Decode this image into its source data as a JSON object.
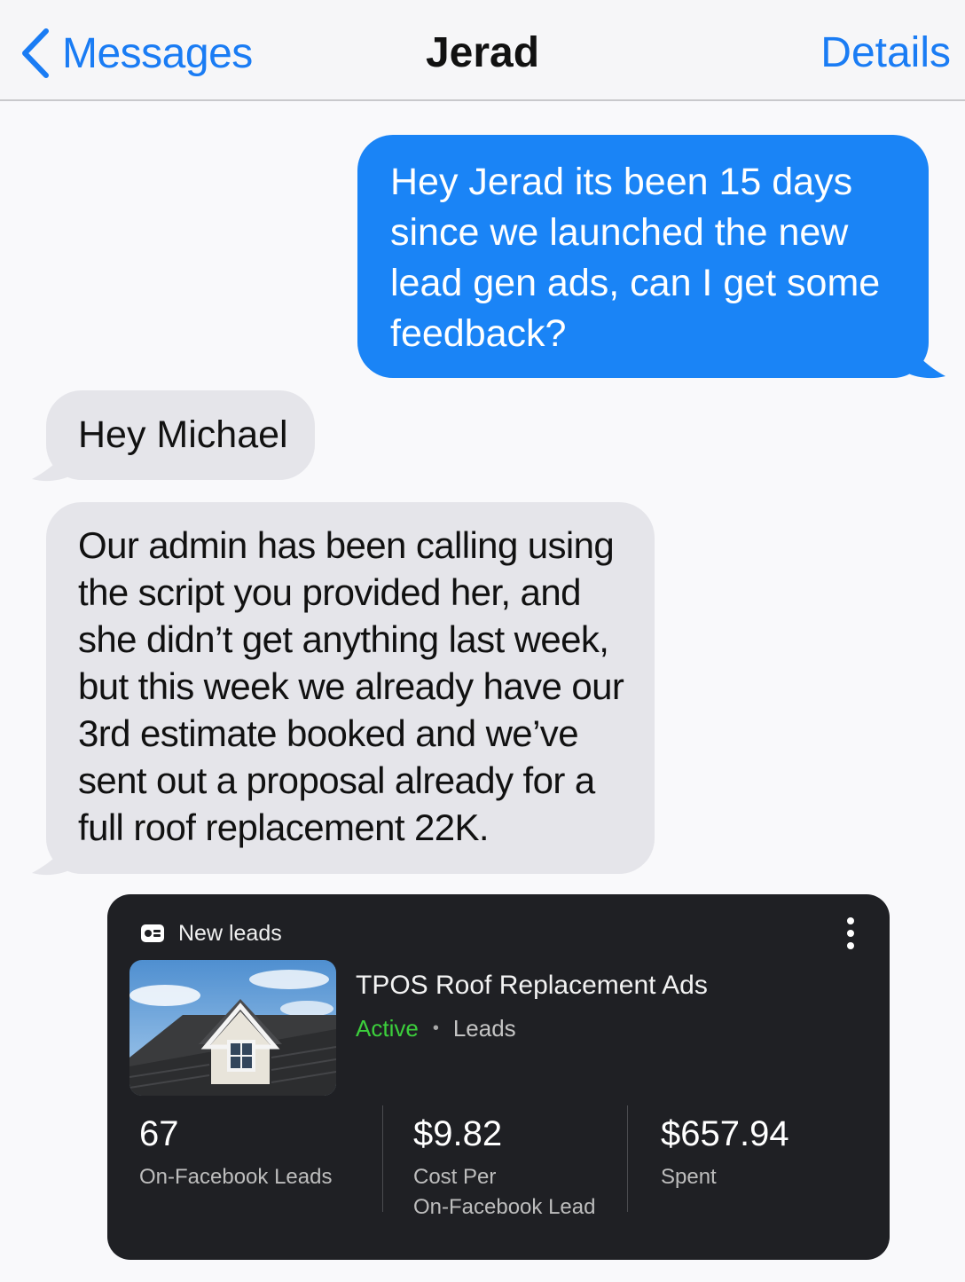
{
  "nav": {
    "back_label": "Messages",
    "title": "Jerad",
    "details_label": "Details"
  },
  "messages": [
    {
      "direction": "outgoing",
      "text": "Hey Jerad its been 15 days since we launched the new lead gen ads, can I get some feedback?"
    },
    {
      "direction": "incoming",
      "text": "Hey Michael"
    },
    {
      "direction": "incoming",
      "text": "Our admin has been calling using the script you provided her, and she didn’t get anything last week, but this week we already have our 3rd estimate booked and we’ve sent out a proposal already for a full roof replacement 22K."
    }
  ],
  "card": {
    "header_label": "New leads",
    "header_icon": "id-card-icon",
    "ad_title": "TPOS Roof Replacement Ads",
    "status": "Active",
    "status_type": "Leads",
    "stats": [
      {
        "value": "67",
        "label_line1": "On-Facebook Leads",
        "label_line2": ""
      },
      {
        "value": "$9.82",
        "label_line1": "Cost Per",
        "label_line2": "On-Facebook Lead"
      },
      {
        "value": "$657.94",
        "label_line1": "Spent",
        "label_line2": ""
      }
    ]
  },
  "colors": {
    "accent_blue": "#1a7cf4",
    "outgoing_bubble": "#1a84f6",
    "incoming_bubble": "#e5e5ea",
    "card_bg": "#1f2024",
    "active_green": "#3ccf3c"
  }
}
